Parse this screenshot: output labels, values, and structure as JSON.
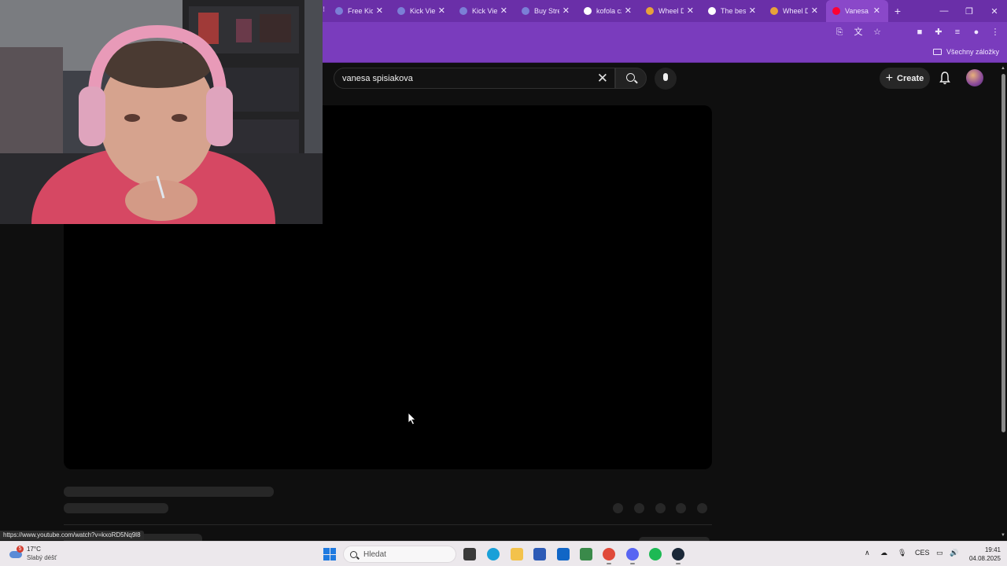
{
  "browser": {
    "tabs": [
      {
        "title": "Free Kick",
        "favicon_color": "#7b7fd6"
      },
      {
        "title": "Kick View",
        "favicon_color": "#7b7fd6"
      },
      {
        "title": "Kick View",
        "favicon_color": "#7b7fd6"
      },
      {
        "title": "Buy Strea",
        "favicon_color": "#7b7fd6"
      },
      {
        "title": "kofola cz",
        "favicon_color": "#ffffff"
      },
      {
        "title": "Wheel D",
        "favicon_color": "#e8a23a"
      },
      {
        "title": "The best",
        "favicon_color": "#ffffff"
      },
      {
        "title": "Wheel D",
        "favicon_color": "#e8a23a"
      },
      {
        "title": "Vanesa Sp",
        "favicon_color": "#ff0033",
        "active": true
      }
    ],
    "bookmarks_all_label": "Všechny záložky",
    "status_url": "https://www.youtube.com/watch?v=kxoRD5Nq9l8",
    "theme_color": "#7a3cbd"
  },
  "youtube": {
    "search_query": "vanesa spisiakova",
    "create_label": "Create"
  },
  "taskbar": {
    "weather_badge": "5",
    "weather_temp": "17°C",
    "weather_desc": "Slabý déšť",
    "search_placeholder": "Hledat",
    "language": "CES",
    "time": "19:41",
    "date": "04.08.2025"
  }
}
